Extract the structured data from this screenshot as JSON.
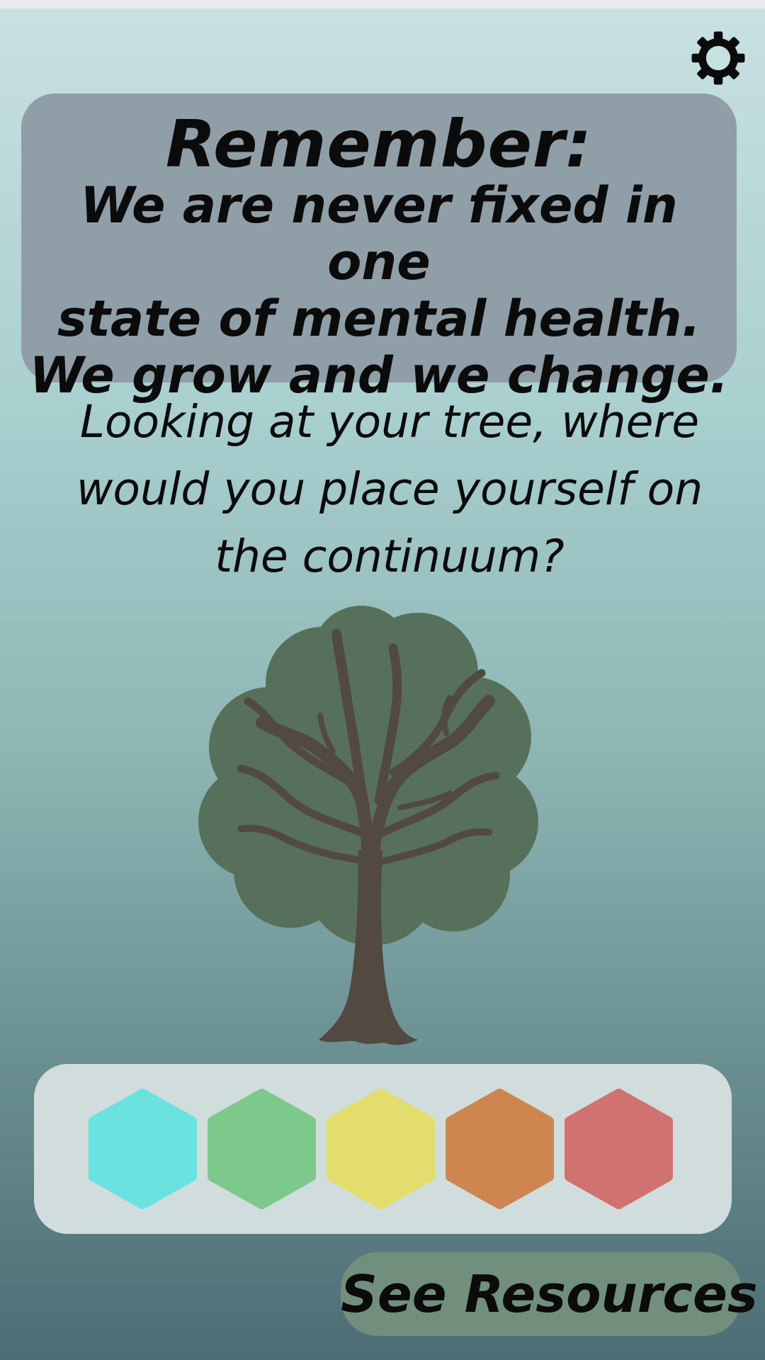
{
  "settings": {
    "icon": "gear-icon"
  },
  "remember_card": {
    "title": "Remember:",
    "message": "We are never fixed in one\nstate of mental health.\nWe grow and we change."
  },
  "question": {
    "text": "Looking at your tree, where\nwould you place yourself on\nthe continuum?"
  },
  "tree": {
    "icon": "tree-icon"
  },
  "continuum": {
    "options": [
      {
        "name": "continuum-option-1",
        "color": "#6ae3e0"
      },
      {
        "name": "continuum-option-2",
        "color": "#7dc88b"
      },
      {
        "name": "continuum-option-3",
        "color": "#e2dd6d"
      },
      {
        "name": "continuum-option-4",
        "color": "#cf854f"
      },
      {
        "name": "continuum-option-5",
        "color": "#d07370"
      }
    ]
  },
  "resources_button": {
    "label": "See Resources"
  },
  "colors": {
    "card": "#8f9ea7",
    "panel": "#d1dcdd",
    "button": "#728e7d",
    "canopy": "#56705b",
    "trunk": "#524a41"
  }
}
